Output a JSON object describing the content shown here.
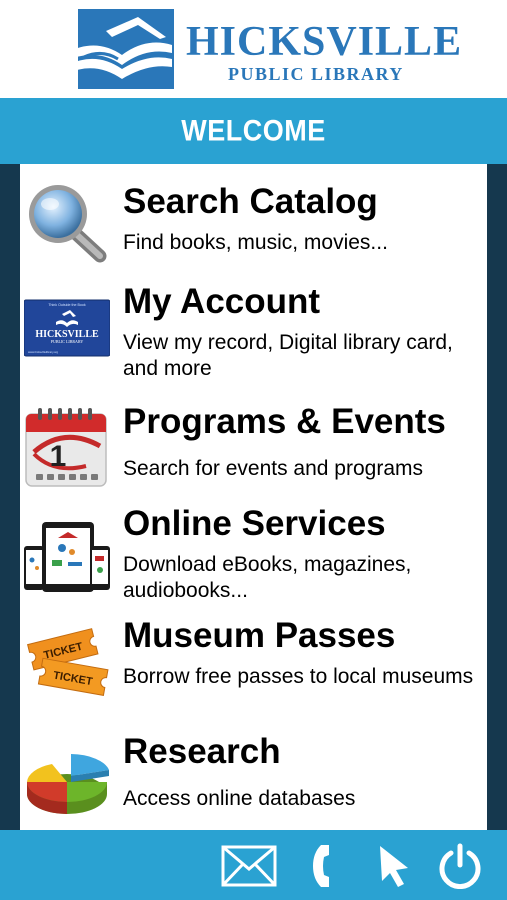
{
  "header": {
    "logo_name": "HICKSVILLE",
    "logo_sub": "PUBLIC LIBRARY"
  },
  "welcome": {
    "label": "WELCOME"
  },
  "menu": {
    "items": [
      {
        "title": "Search Catalog",
        "desc": "Find books, music, movies...",
        "icon": "magnifier-icon"
      },
      {
        "title": "My Account",
        "desc": "View my record, Digital library card, and more",
        "icon": "library-card-icon"
      },
      {
        "title": "Programs & Events",
        "desc": "Search for events and programs",
        "icon": "calendar-icon"
      },
      {
        "title": "Online Services",
        "desc": "Download eBooks, magazines, audiobooks...",
        "icon": "devices-icon"
      },
      {
        "title": "Museum Passes",
        "desc": "Borrow free passes to local museums",
        "icon": "tickets-icon"
      },
      {
        "title": "Research",
        "desc": "Access online databases",
        "icon": "pie-chart-icon"
      }
    ]
  },
  "card": {
    "top_text": "Think Outside the Book",
    "name": "HICKSVILLE",
    "sub": "PUBLIC LIBRARY",
    "url": "www.hicksvillelibrary.org"
  },
  "calendar_day": "1",
  "ticket_text": "TICKET",
  "colors": {
    "brand_blue": "#2a77b9",
    "band_blue": "#2aa2d2",
    "side_dark": "#15384e"
  },
  "footer": {
    "buttons": [
      "mail-icon",
      "phone-icon",
      "pointer-icon",
      "power-icon"
    ]
  }
}
